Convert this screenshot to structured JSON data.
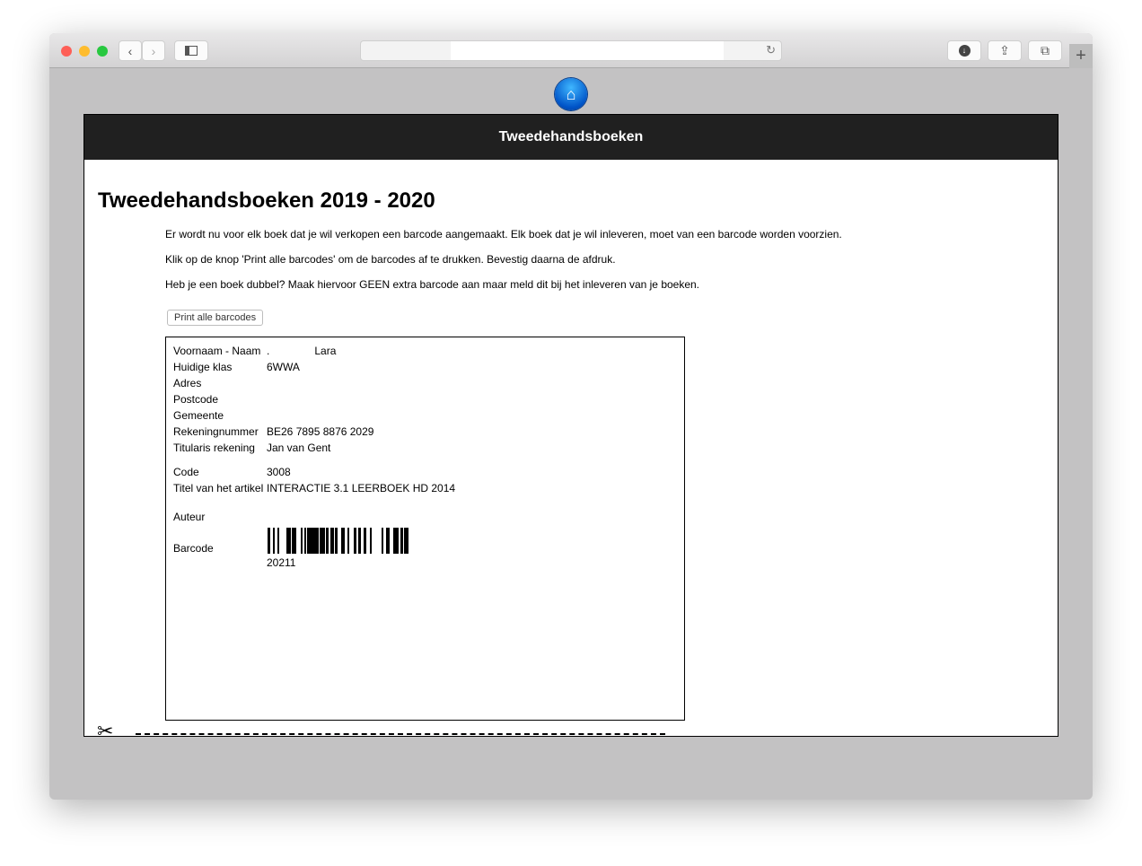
{
  "browser": {
    "new_tab": "+"
  },
  "header": {
    "title": "Tweedehandsboeken"
  },
  "main": {
    "heading": "Tweedehandsboeken 2019 - 2020",
    "paragraphs": [
      "Er wordt nu voor elk boek dat je wil verkopen een barcode aangemaakt. Elk boek dat je wil inleveren, moet van een barcode worden voorzien.",
      "Klik op de knop 'Print alle barcodes' om de barcodes af te drukken. Bevestig daarna de afdruk.",
      "Heb je een boek dubbel? Maak hiervoor GEEN extra barcode aan maar meld dit bij het inleveren van je boeken."
    ],
    "print_button": "Print alle barcodes"
  },
  "card": {
    "rows": [
      {
        "label": "Voornaam - Naam",
        "value": ".               Lara"
      },
      {
        "label": "Huidige klas",
        "value": "6WWA"
      },
      {
        "label": "Adres",
        "value": ""
      },
      {
        "label": "Postcode",
        "value": ""
      },
      {
        "label": "Gemeente",
        "value": ""
      },
      {
        "label": "Rekeningnummer",
        "value": "BE26 7895 8876 2029"
      },
      {
        "label": "Titularis rekening",
        "value": "Jan van Gent"
      },
      {
        "label": "Code",
        "value": "3008"
      },
      {
        "label": "Titel van het artikel",
        "value": "INTERACTIE 3.1 LEERBOEK HD 2014"
      },
      {
        "label": "Auteur",
        "value": ""
      },
      {
        "label": "Barcode",
        "value": ""
      }
    ],
    "barcode_number": "20211"
  }
}
